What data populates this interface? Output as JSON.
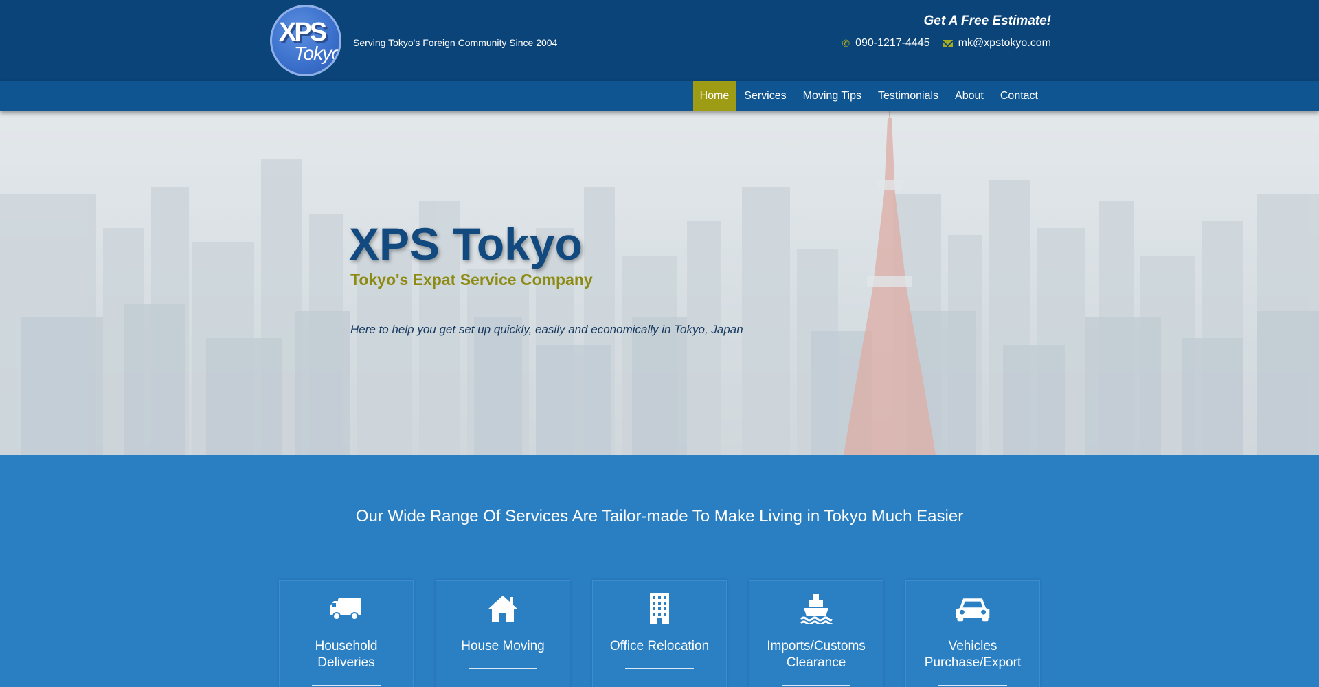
{
  "header": {
    "logo_line1": "XPS",
    "logo_line2": "Tokyo",
    "tagline": "Serving Tokyo's Foreign Community Since 2004",
    "estimate_text": "Get A Free Estimate!",
    "phone": "090-1217-4445",
    "email": "mk@xpstokyo.com",
    "phone_icon": "phone-icon",
    "email_icon": "envelope-icon"
  },
  "nav": {
    "items": [
      {
        "label": "Home",
        "active": true
      },
      {
        "label": "Services",
        "active": false
      },
      {
        "label": "Moving Tips",
        "active": false
      },
      {
        "label": "Testimonials",
        "active": false
      },
      {
        "label": "About",
        "active": false
      },
      {
        "label": "Contact",
        "active": false
      }
    ]
  },
  "hero": {
    "title": "XPS Tokyo",
    "subtitle": "Tokyo's Expat Service Company",
    "description": "Here to help you get set up quickly, easily and economically in Tokyo, Japan"
  },
  "services": {
    "heading": "Our Wide Range Of Services Are Tailor-made To Make Living in Tokyo Much Easier",
    "cards": [
      {
        "label_1": "Household",
        "label_2": "Deliveries",
        "icon": "truck-icon"
      },
      {
        "label_1": "House Moving",
        "label_2": "",
        "icon": "house-icon"
      },
      {
        "label_1": "Office Relocation",
        "label_2": "",
        "icon": "office-building-icon"
      },
      {
        "label_1": "Imports/Customs",
        "label_2": "Clearance",
        "icon": "ship-icon"
      },
      {
        "label_1": "Vehicles",
        "label_2": "Purchase/Export",
        "icon": "car-icon"
      }
    ]
  },
  "colors": {
    "header_bg": "#0b4479",
    "nav_bg": "#0f5591",
    "accent": "#9e9b14",
    "services_bg": "#2a7ec2",
    "title_blue": "#124a80",
    "subtitle_olive": "#8d8a12"
  }
}
